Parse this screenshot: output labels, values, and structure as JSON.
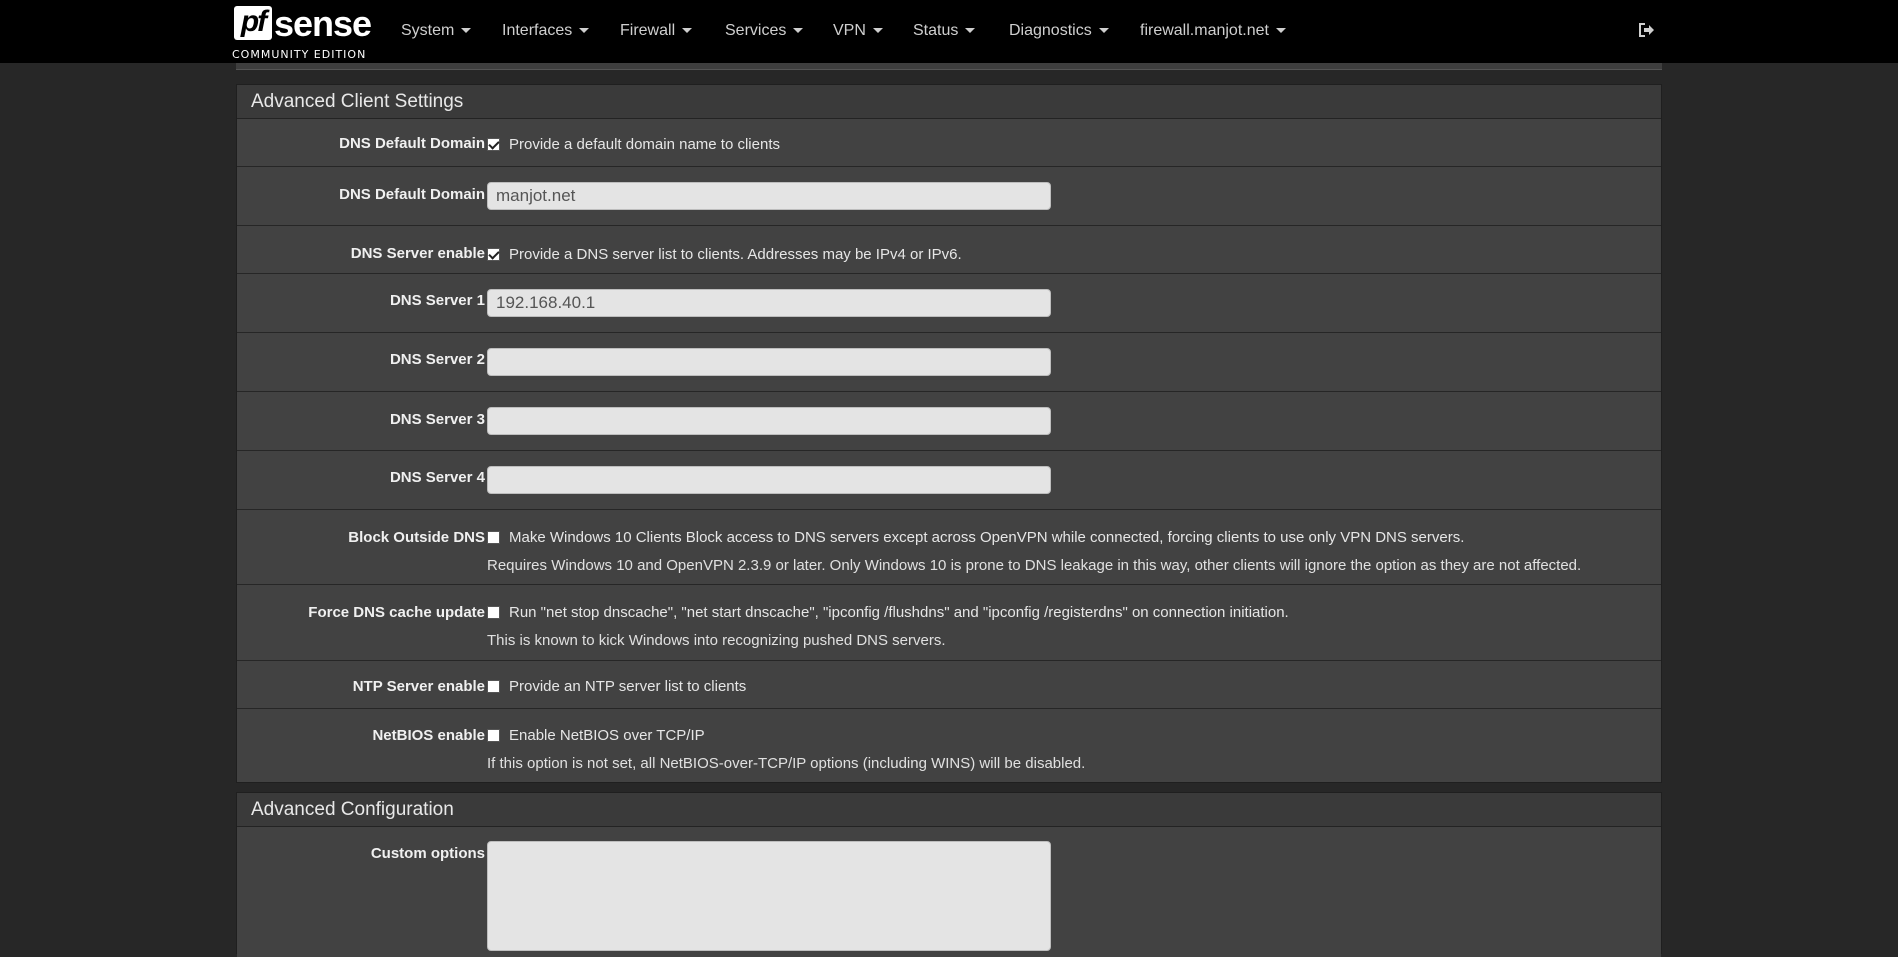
{
  "brand": {
    "logo_pf": "pf",
    "logo_sense": "sense",
    "edition": "COMMUNITY EDITION"
  },
  "nav": {
    "items": [
      "System",
      "Interfaces",
      "Firewall",
      "Services",
      "VPN",
      "Status",
      "Diagnostics",
      "firewall.manjot.net"
    ],
    "logout_icon": "sign-out-icon"
  },
  "client_settings": {
    "heading": "Advanced Client Settings",
    "dns_default_domain_enable": {
      "label": "DNS Default Domain",
      "checked": true,
      "text": "Provide a default domain name to clients"
    },
    "dns_default_domain": {
      "label": "DNS Default Domain",
      "value": "manjot.net"
    },
    "dns_server_enable": {
      "label": "DNS Server enable",
      "checked": true,
      "text": "Provide a DNS server list to clients. Addresses may be IPv4 or IPv6."
    },
    "dns_server_1": {
      "label": "DNS Server 1",
      "value": "192.168.40.1"
    },
    "dns_server_2": {
      "label": "DNS Server 2",
      "value": ""
    },
    "dns_server_3": {
      "label": "DNS Server 3",
      "value": ""
    },
    "dns_server_4": {
      "label": "DNS Server 4",
      "value": ""
    },
    "block_outside_dns": {
      "label": "Block Outside DNS",
      "checked": false,
      "text": "Make Windows 10 Clients Block access to DNS servers except across OpenVPN while connected, forcing clients to use only VPN DNS servers.",
      "help": "Requires Windows 10 and OpenVPN 2.3.9 or later. Only Windows 10 is prone to DNS leakage in this way, other clients will ignore the option as they are not affected."
    },
    "force_dns_cache_update": {
      "label": "Force DNS cache update",
      "checked": false,
      "text": "Run \"net stop dnscache\", \"net start dnscache\", \"ipconfig /flushdns\" and \"ipconfig /registerdns\" on connection initiation.",
      "help": "This is known to kick Windows into recognizing pushed DNS servers."
    },
    "ntp_server_enable": {
      "label": "NTP Server enable",
      "checked": false,
      "text": "Provide an NTP server list to clients"
    },
    "netbios_enable": {
      "label": "NetBIOS enable",
      "checked": false,
      "text": "Enable NetBIOS over TCP/IP",
      "help": "If this option is not set, all NetBIOS-over-TCP/IP options (including WINS) will be disabled."
    }
  },
  "advanced_config": {
    "heading": "Advanced Configuration",
    "custom_options": {
      "label": "Custom options",
      "value": ""
    }
  }
}
